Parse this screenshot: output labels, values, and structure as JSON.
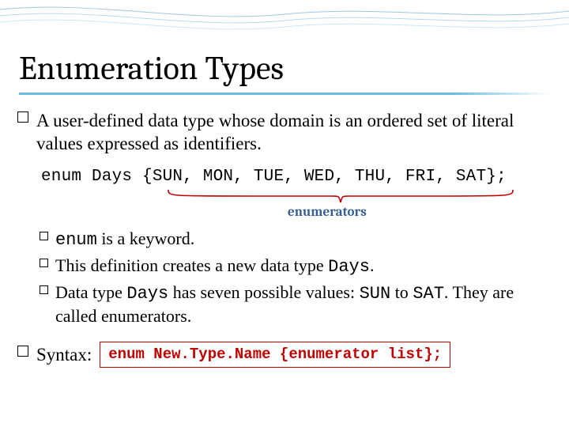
{
  "title": "Enumeration Types",
  "definition_pre": "A user-defined data type whose domain is an ordered set of literal values expressed as identifiers.",
  "enum_line": "enum Days {SUN, MON, TUE, WED, THU, FRI, SAT};",
  "enumerators_label": "enumerators",
  "sub1_code": "enum",
  "sub1_rest": " is a keyword.",
  "sub2_pre": "This definition creates a new data type ",
  "sub2_code": "Days",
  "sub2_post": ".",
  "sub3_pre": "Data type ",
  "sub3_code1": "Days",
  "sub3_mid": " has seven possible values: ",
  "sub3_code2": "SUN",
  "sub3_mid2": " to ",
  "sub3_code3": "SAT",
  "sub3_post": ". They are called enumerators.",
  "syntax_label": "Syntax:",
  "syntax_box": "enum New.Type.Name {enumerator list};",
  "colors": {
    "brace": "#c00000",
    "label": "#365f91",
    "underline": "#6bbde0"
  }
}
